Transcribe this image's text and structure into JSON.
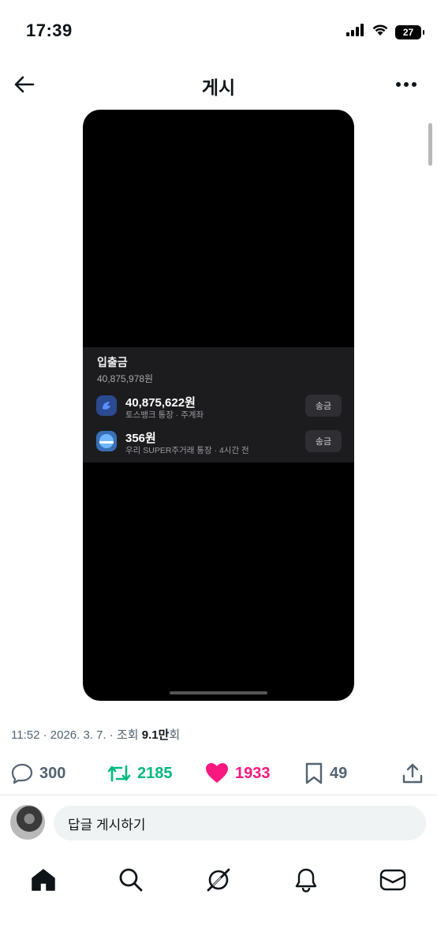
{
  "status_bar": {
    "time": "17:39",
    "battery": "27",
    "icons": [
      "signal-icon",
      "wifi-icon",
      "battery-icon"
    ]
  },
  "header": {
    "title": "게시",
    "back_icon": "arrow-left-icon",
    "more_icon": "more-horizontal-icon"
  },
  "post_image": {
    "panel_title": "입출금",
    "panel_total": "40,875,978원",
    "accounts": [
      {
        "amount": "40,875,622원",
        "sub": "토스뱅크 통장 · 주계좌",
        "button": "송금",
        "icon": "toss-bank-icon"
      },
      {
        "amount": "356원",
        "sub": "우리 SUPER주거래 통장 · 4시간 전",
        "button": "송금",
        "icon": "woori-bank-icon"
      }
    ]
  },
  "meta": {
    "time_date": "11:52 · 2026. 3. 7. · 조회 ",
    "views": "9.1만",
    "views_suffix": "회"
  },
  "actions": {
    "replies": "300",
    "reposts": "2185",
    "likes": "1933",
    "bookmarks": "49"
  },
  "colors": {
    "repost": "#00ba7c",
    "like": "#f91880",
    "muted": "#536471"
  },
  "reply": {
    "placeholder": "답글 게시하기"
  },
  "nav": [
    "home-icon",
    "search-icon",
    "grok-icon",
    "notifications-icon",
    "messages-icon"
  ]
}
